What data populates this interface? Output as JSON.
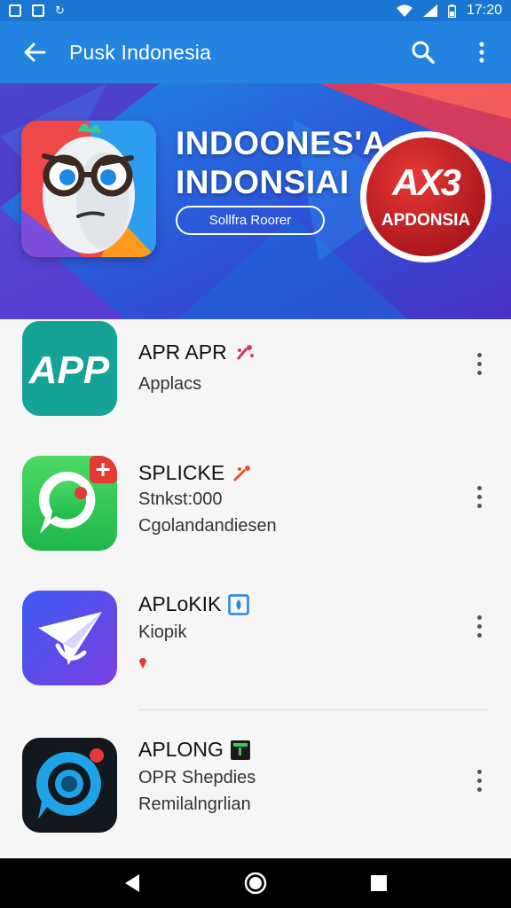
{
  "status_bar": {
    "time": "17:20"
  },
  "app_bar": {
    "title": "Pusk Indonesia"
  },
  "banner": {
    "title_line1": "INDOONES'A",
    "title_line2": "INDONSIAI",
    "button_label": "Sollfra Roorer",
    "badge_logo": "AX3",
    "badge_text": "APDONSIA"
  },
  "apps": [
    {
      "icon_text": "APP",
      "name": "APR APR",
      "line1": "Applacs",
      "line2": ""
    },
    {
      "name": "SPLICKE",
      "line1": "Stnkst:000",
      "line2": "Cgolandandiesen"
    },
    {
      "name": "APLoKIK",
      "line1": "Kiopik",
      "line2": ""
    },
    {
      "name": "APLONG",
      "line1": "OPR Shepdies",
      "line2": "Remilalngrlian"
    }
  ],
  "colors": {
    "app_bar": "#2283e0",
    "status_bar": "#1976d2",
    "accent_red": "#d32f2f"
  }
}
